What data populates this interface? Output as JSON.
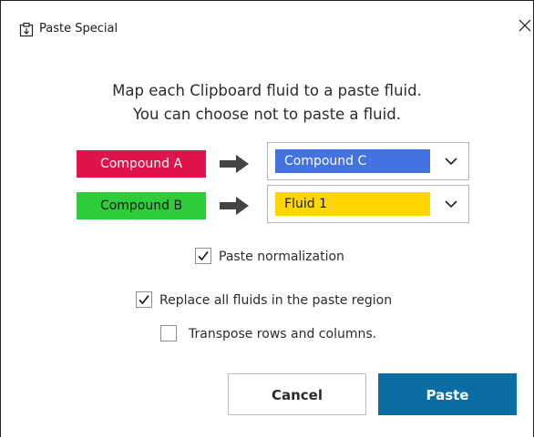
{
  "window": {
    "title": "Paste Special",
    "icon": "clipboard-icon",
    "close_icon": "close-icon"
  },
  "instructions": {
    "line1": "Map each Clipboard fluid to a paste fluid.",
    "line2": "You can choose not to paste a fluid."
  },
  "mappings": [
    {
      "source": "Compound A",
      "source_color": "#e0144b",
      "target": "Compound C",
      "target_color": "#4472e0"
    },
    {
      "source": "Compound B",
      "source_color": "#2ecc3a",
      "target": "Fluid 1",
      "target_color": "#ffd600"
    }
  ],
  "options": {
    "paste_normalization": {
      "label": "Paste normalization",
      "checked": true
    },
    "replace_all": {
      "label": "Replace all fluids in the paste region",
      "checked": true
    },
    "transpose": {
      "label": "Transpose rows and columns.",
      "checked": false
    }
  },
  "buttons": {
    "cancel": "Cancel",
    "paste": "Paste",
    "paste_color": "#0a6ea3"
  }
}
